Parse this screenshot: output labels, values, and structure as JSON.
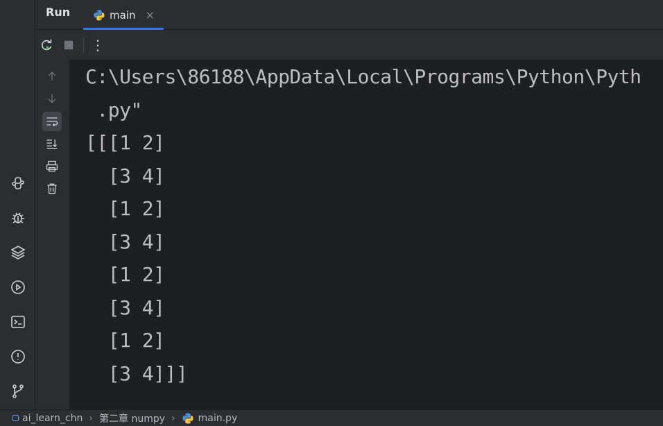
{
  "toolwindow": {
    "title": "Run",
    "tab_label": "main",
    "tab_close": "×"
  },
  "toolbar": {
    "rerun": "rerun-icon",
    "stop": "stop-icon",
    "more": "⋮"
  },
  "gutter_icons": [
    "arrow-up-icon",
    "arrow-down-icon",
    "soft-wrap-icon",
    "scroll-to-end-icon",
    "print-icon",
    "trash-icon"
  ],
  "left_tools": [
    "python-console-icon",
    "debug-icon",
    "layers-icon",
    "services-icon",
    "terminal-icon",
    "problems-icon",
    "git-icon"
  ],
  "console": {
    "lines": [
      "C:\\Users\\86188\\AppData\\Local\\Programs\\Python\\Pyth",
      " .py\"",
      "[[[1 2]",
      "  [3 4]",
      "  [1 2]",
      "  [3 4]",
      "  [1 2]",
      "  [3 4]",
      "  [1 2]",
      "  [3 4]]]"
    ]
  },
  "statusbar": {
    "project": "ai_learn_chn",
    "folder": "第二章 numpy",
    "file": "main.py"
  },
  "colors": {
    "accent": "#3574f0",
    "bg_editor": "#1e1f22",
    "bg_panel": "#2b2d30",
    "text": "#bcbec4"
  }
}
